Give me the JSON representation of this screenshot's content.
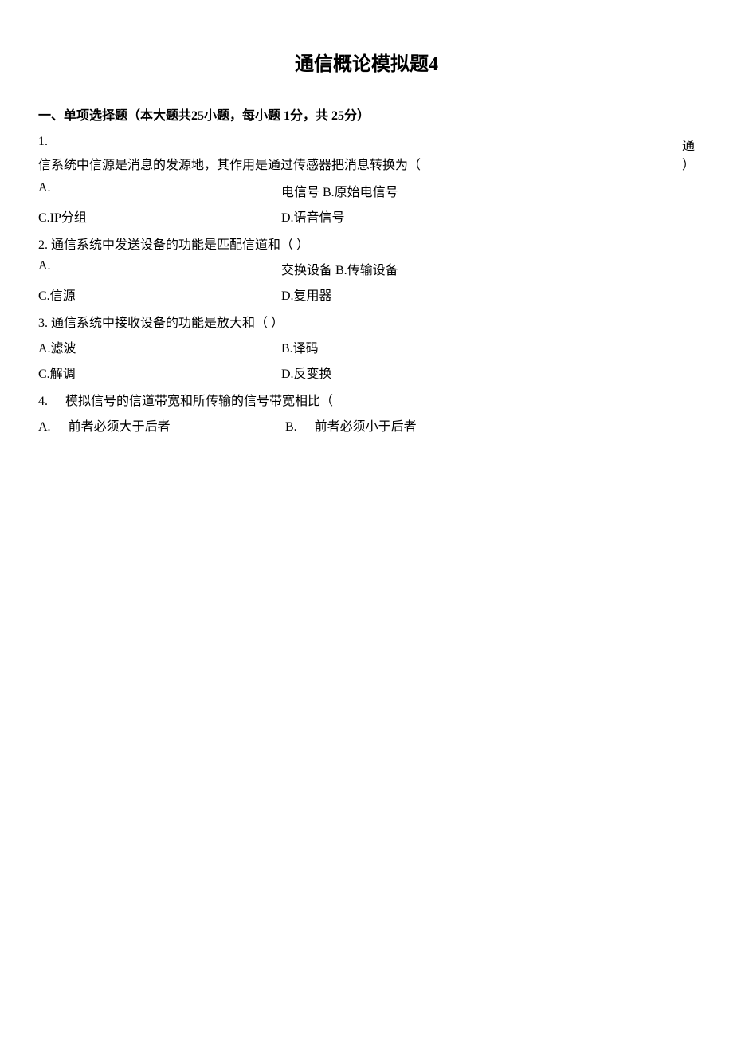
{
  "title": "通信概论模拟题4",
  "section_header": "一、单项选择题（本大题共25小题，每小题 1分，共 25分）",
  "q1": {
    "num_and_tail_char": "1.",
    "trail_right": "通",
    "line2_left": "信系统中信源是消息的发源地，其作用是通过传感器把消息转换为（",
    "line2_right": "）",
    "optA_left": "A.",
    "optA_right": "电信号   B.原始电信号",
    "optC": "C.IP分组",
    "optD": "D.语音信号"
  },
  "q2": {
    "text": "2.  通信系统中发送设备的功能是匹配信道和（      ）",
    "optA_left": "A.",
    "optA_right": "交换设备      B.传输设备",
    "optC": "C.信源",
    "optD": "D.复用器"
  },
  "q3": {
    "text": "3.  通信系统中接收设备的功能是放大和（  ）",
    "optA": "A.滤波",
    "optB": "B.译码",
    "optC": "C.解调",
    "optD": "D.反变换"
  },
  "q4": {
    "num": "4.",
    "text": "模拟信号的信道带宽和所传输的信号带宽相比（",
    "optA_lab": "A.",
    "optA_txt": "前者必须大于后者",
    "optB_lab": "B.",
    "optB_txt": "前者必须小于后者"
  }
}
